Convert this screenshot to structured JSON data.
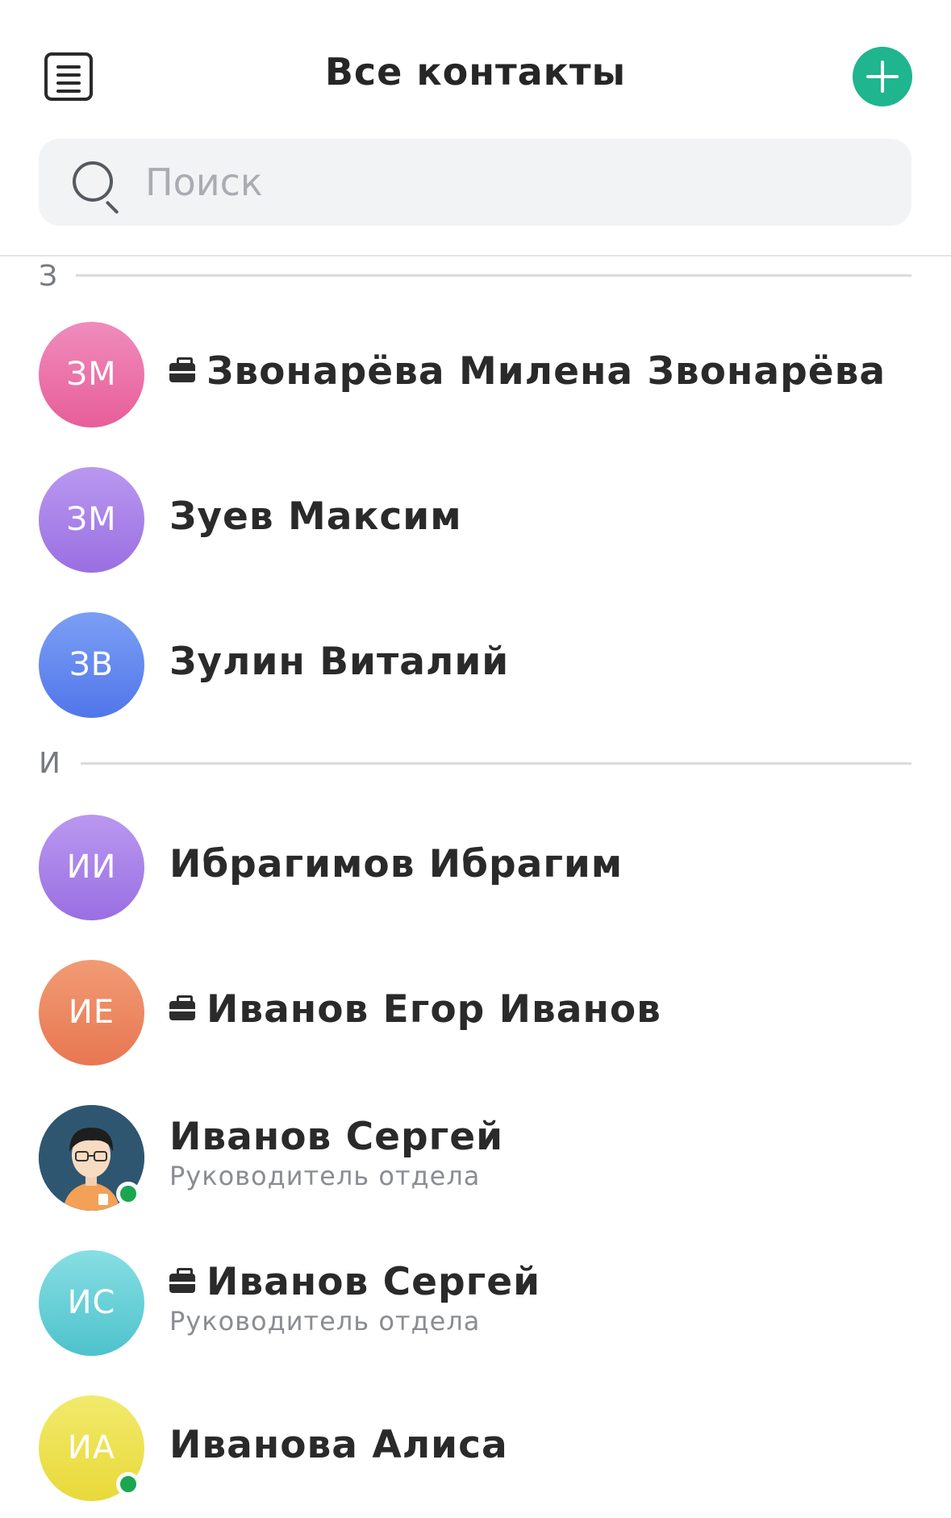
{
  "header": {
    "title": "Все контакты",
    "menu_icon": "list-icon",
    "add_icon": "plus-icon",
    "accent_color": "#1fb58f"
  },
  "search": {
    "placeholder": "Поиск",
    "icon": "search-icon"
  },
  "sections": [
    {
      "letter": "З",
      "contacts": [
        {
          "initials": "ЗМ",
          "name": "Звонарёва Милена Звонарёва",
          "work_badge": true,
          "color": "#ea6fa6"
        },
        {
          "initials": "ЗМ",
          "name": "Зуев Максим",
          "color": "#a57fe6"
        },
        {
          "initials": "ЗВ",
          "name": "Зулин Виталий",
          "color": "#5f84ef"
        }
      ]
    },
    {
      "letter": "И",
      "contacts": [
        {
          "initials": "ИИ",
          "name": "Ибрагимов Ибрагим",
          "color": "#a57fe6"
        },
        {
          "initials": "ИЕ",
          "name": "Иванов Егор Иванов",
          "work_badge": true,
          "color": "#ec8761"
        },
        {
          "name": "Иванов Сергей",
          "subtitle": "Руководитель отдела",
          "photo": true,
          "online": true
        },
        {
          "initials": "ИС",
          "name": "Иванов Сергей",
          "subtitle": "Руководитель отдела",
          "work_badge": true,
          "color": "#5ccbd4"
        },
        {
          "initials": "ИА",
          "name": "Иванова Алиса",
          "online": true,
          "color": "#ecdf43"
        }
      ]
    }
  ]
}
